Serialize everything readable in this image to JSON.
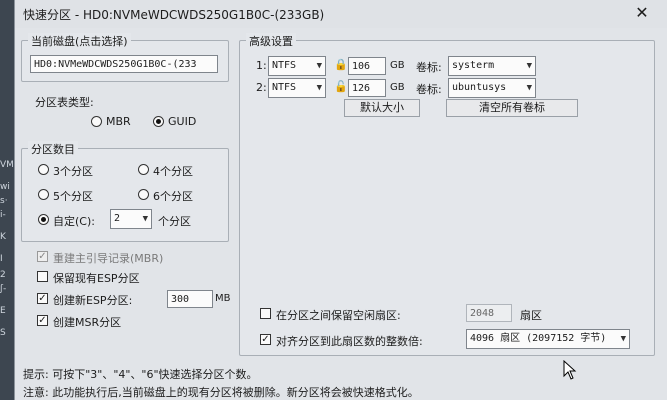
{
  "background": {
    "fragments": [
      "VM",
      "wi",
      "s·",
      "i-",
      "K",
      "I",
      "2",
      "ʃ-",
      "E",
      "S"
    ]
  },
  "window": {
    "title": "快速分区 - HD0:NVMeWDCWDS250G1B0C-(233GB)",
    "close_symbol": "✕"
  },
  "disk": {
    "group_title": "当前磁盘(点击选择)",
    "selected": "HD0:NVMeWDCWDS250G1B0C-(233"
  },
  "partition_table": {
    "label": "分区表类型:",
    "options": [
      {
        "label": "MBR",
        "selected": false
      },
      {
        "label": "GUID",
        "selected": true
      }
    ]
  },
  "partition_count": {
    "group_title": "分区数目",
    "options": [
      {
        "label": "3个分区",
        "selected": false
      },
      {
        "label": "4个分区",
        "selected": false
      },
      {
        "label": "5个分区",
        "selected": false
      },
      {
        "label": "6个分区",
        "selected": false
      }
    ],
    "custom": {
      "label": "自定(C):",
      "selected": true,
      "value": "2",
      "suffix": "个分区"
    }
  },
  "options": {
    "rebuild_mbr": {
      "label": "重建主引导记录(MBR)",
      "checked": true,
      "disabled": true
    },
    "keep_esp": {
      "label": "保留现有ESP分区",
      "checked": false
    },
    "create_esp": {
      "label": "创建新ESP分区:",
      "checked": true,
      "size": "300",
      "unit": "MB"
    },
    "create_msr": {
      "label": "创建MSR分区",
      "checked": true
    }
  },
  "advanced": {
    "group_title": "高级设置",
    "rows": [
      {
        "index": "1:",
        "fs": "NTFS",
        "size": "106",
        "unit": "GB",
        "label_caption": "卷标:",
        "volume_label": "systerm",
        "lock_icon": "lock-closed-icon"
      },
      {
        "index": "2:",
        "fs": "NTFS",
        "size": "126",
        "unit": "GB",
        "label_caption": "卷标:",
        "volume_label": "ubuntusys",
        "lock_icon": "lock-open-icon"
      }
    ],
    "default_size_button": "默认大小",
    "clear_labels_button": "清空所有卷标"
  },
  "alignment": {
    "reserve_gap": {
      "label": "在分区之间保留空闲扇区:",
      "checked": false,
      "value": "2048",
      "unit": "扇区"
    },
    "align": {
      "label": "对齐分区到此扇区数的整数倍:",
      "checked": true,
      "value": "4096 扇区 (2097152 字节)"
    }
  },
  "footer": {
    "tip": "提示: 可按下\"3\"、\"4\"、\"6\"快速选择分区个数。",
    "note": "注意: 此功能执行后,当前磁盘上的现有分区将被删除。新分区将会被快速格式化。"
  }
}
